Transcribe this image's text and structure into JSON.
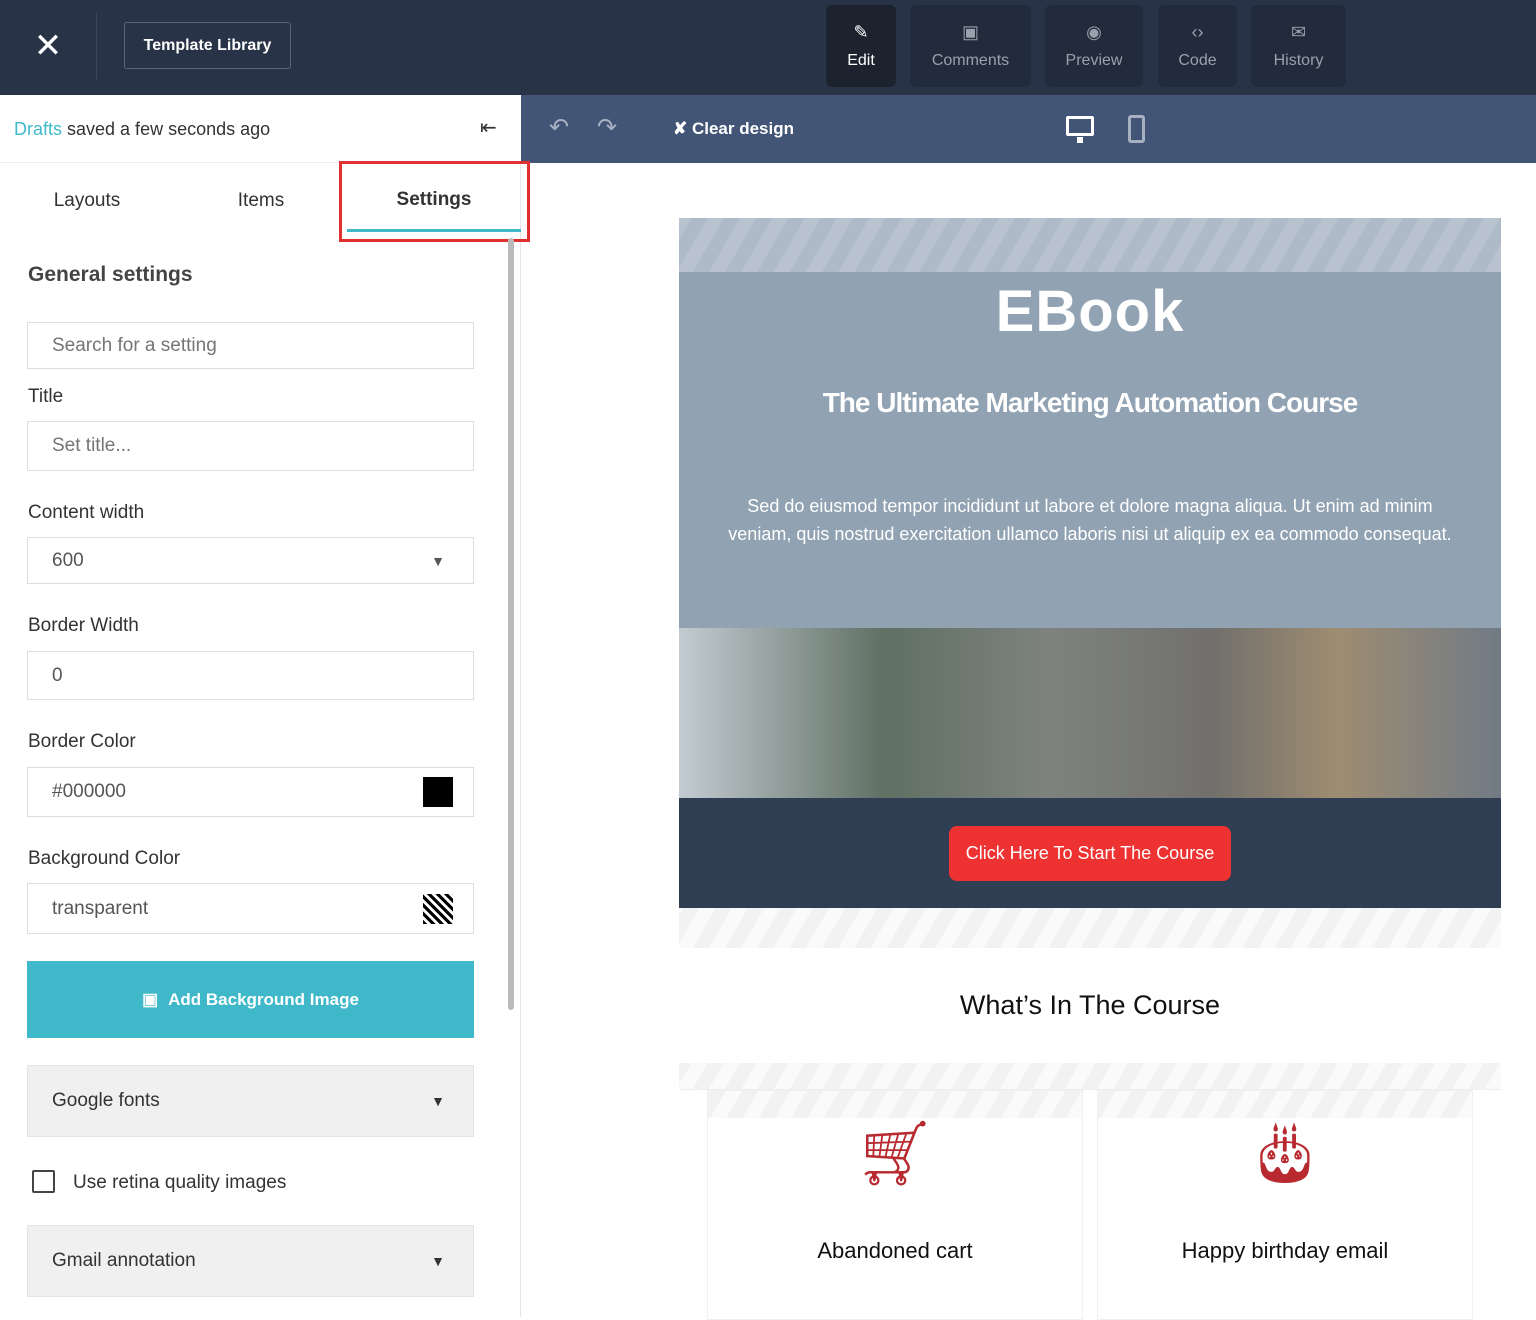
{
  "topbar": {
    "close_icon": "close-icon",
    "template_library": "Template Library",
    "modes": [
      {
        "label": "Edit",
        "icon": "✎",
        "active": true
      },
      {
        "label": "Comments",
        "icon": "🗪"
      },
      {
        "label": "Preview",
        "icon": "◉"
      },
      {
        "label": "Code",
        "icon": "‹›"
      },
      {
        "label": "History",
        "icon": "✉"
      }
    ]
  },
  "sidebar": {
    "drafts_link": "Drafts",
    "saved_status": " saved a few seconds ago",
    "tabs": [
      "Layouts",
      "Items",
      "Settings"
    ],
    "active_tab": "Settings",
    "section_title": "General settings",
    "search_placeholder": "Search for a setting",
    "title_label": "Title",
    "title_placeholder": "Set title...",
    "content_width_label": "Content width",
    "content_width_value": "600",
    "border_width_label": "Border Width",
    "border_width_value": "0",
    "border_color_label": "Border Color",
    "border_color_value": "#000000",
    "background_color_label": "Background Color",
    "background_color_value": "transparent",
    "add_bg_image": "Add Background Image",
    "google_fonts": "Google fonts",
    "retina_label": "Use retina quality images",
    "retina_checked": false,
    "gmail_annotation": "Gmail annotation"
  },
  "subbar": {
    "clear_design": "Clear design"
  },
  "email": {
    "logo": "EBook",
    "headline": "The Ultimate Marketing Automation Course",
    "body": "Sed do eiusmod tempor incididunt ut labore et dolore magna aliqua. Ut enim ad minim veniam, quis nostrud exercitation ullamco laboris nisi ut aliquip ex ea commodo consequat.",
    "cta": "Click Here To Start The Course",
    "section_title": "What’s In The Course",
    "items": [
      {
        "label": "Abandoned cart",
        "icon": "shopping-cart-icon"
      },
      {
        "label": "Happy birthday email",
        "icon": "birthday-cake-icon"
      }
    ]
  },
  "colors": {
    "accent": "#3fb9c9",
    "cta": "#ee3131",
    "topbar": "#283347",
    "subbar": "#425576",
    "highlight": "#e03030"
  }
}
